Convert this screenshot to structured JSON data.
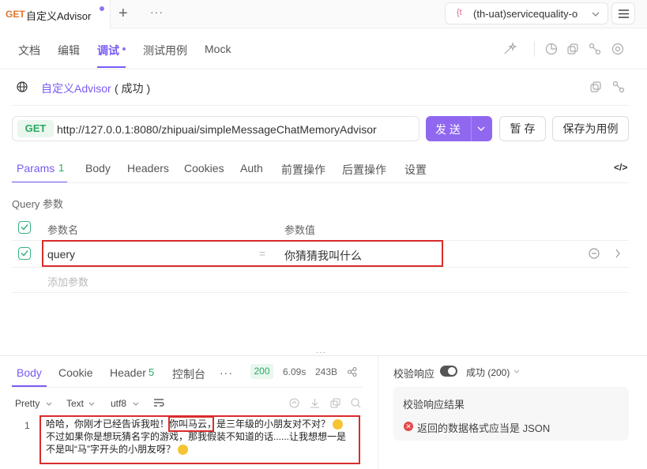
{
  "topbar": {
    "tab_method": "GET",
    "tab_title": "自定义Advisor",
    "env_icon": "{t",
    "env_label": "(th-uat)servicequality-o"
  },
  "subtabs": [
    "文档",
    "编辑",
    "调试",
    "测试用例",
    "Mock"
  ],
  "request": {
    "name": "自定义Advisor",
    "status": "( 成功 )",
    "method": "GET",
    "url": "http://127.0.0.1:8080/zhipuai/simpleMessageChatMemoryAdvisor",
    "send_label": "发 送",
    "save_label": "暂 存",
    "save_case_label": "保存为用例"
  },
  "req_tabs": {
    "params": "Params",
    "params_count": "1",
    "body": "Body",
    "headers": "Headers",
    "cookies": "Cookies",
    "auth": "Auth",
    "pre": "前置操作",
    "post": "后置操作",
    "settings": "设置"
  },
  "query": {
    "section_title": "Query 参数",
    "col_name": "参数名",
    "col_value": "参数值",
    "row_name": "query",
    "row_eq": "=",
    "row_value": "你猜猜我叫什么",
    "add_placeholder": "添加参数"
  },
  "response": {
    "tab_body": "Body",
    "tab_cookie": "Cookie",
    "tab_header": "Header",
    "header_count": "5",
    "tab_console": "控制台",
    "more": "···",
    "status_code": "200",
    "time": "6.09s",
    "size": "243B",
    "fmt_pretty": "Pretty",
    "fmt_text": "Text",
    "fmt_charset": "utf8",
    "line_no": "1",
    "line1_a": "哈哈，你刚才已经告诉我啦！",
    "line1_hl": "你叫马云，",
    "line1_b": "是三年级的小朋友对不对？",
    "line2": "不过如果你是想玩猜名字的游戏，那我假装不知道的话......让我想想一是",
    "line3": "不是叫“马”字开头的小朋友呀？"
  },
  "validate": {
    "label": "校验响应",
    "status": "成功 (200)",
    "panel_title": "校验响应结果",
    "error_text": "返回的数据格式应当是 JSON"
  },
  "colors": {
    "accent": "#7a5af5",
    "get": "#2aa862",
    "error": "#e5484d",
    "highlight_box": "#d92b2b"
  }
}
